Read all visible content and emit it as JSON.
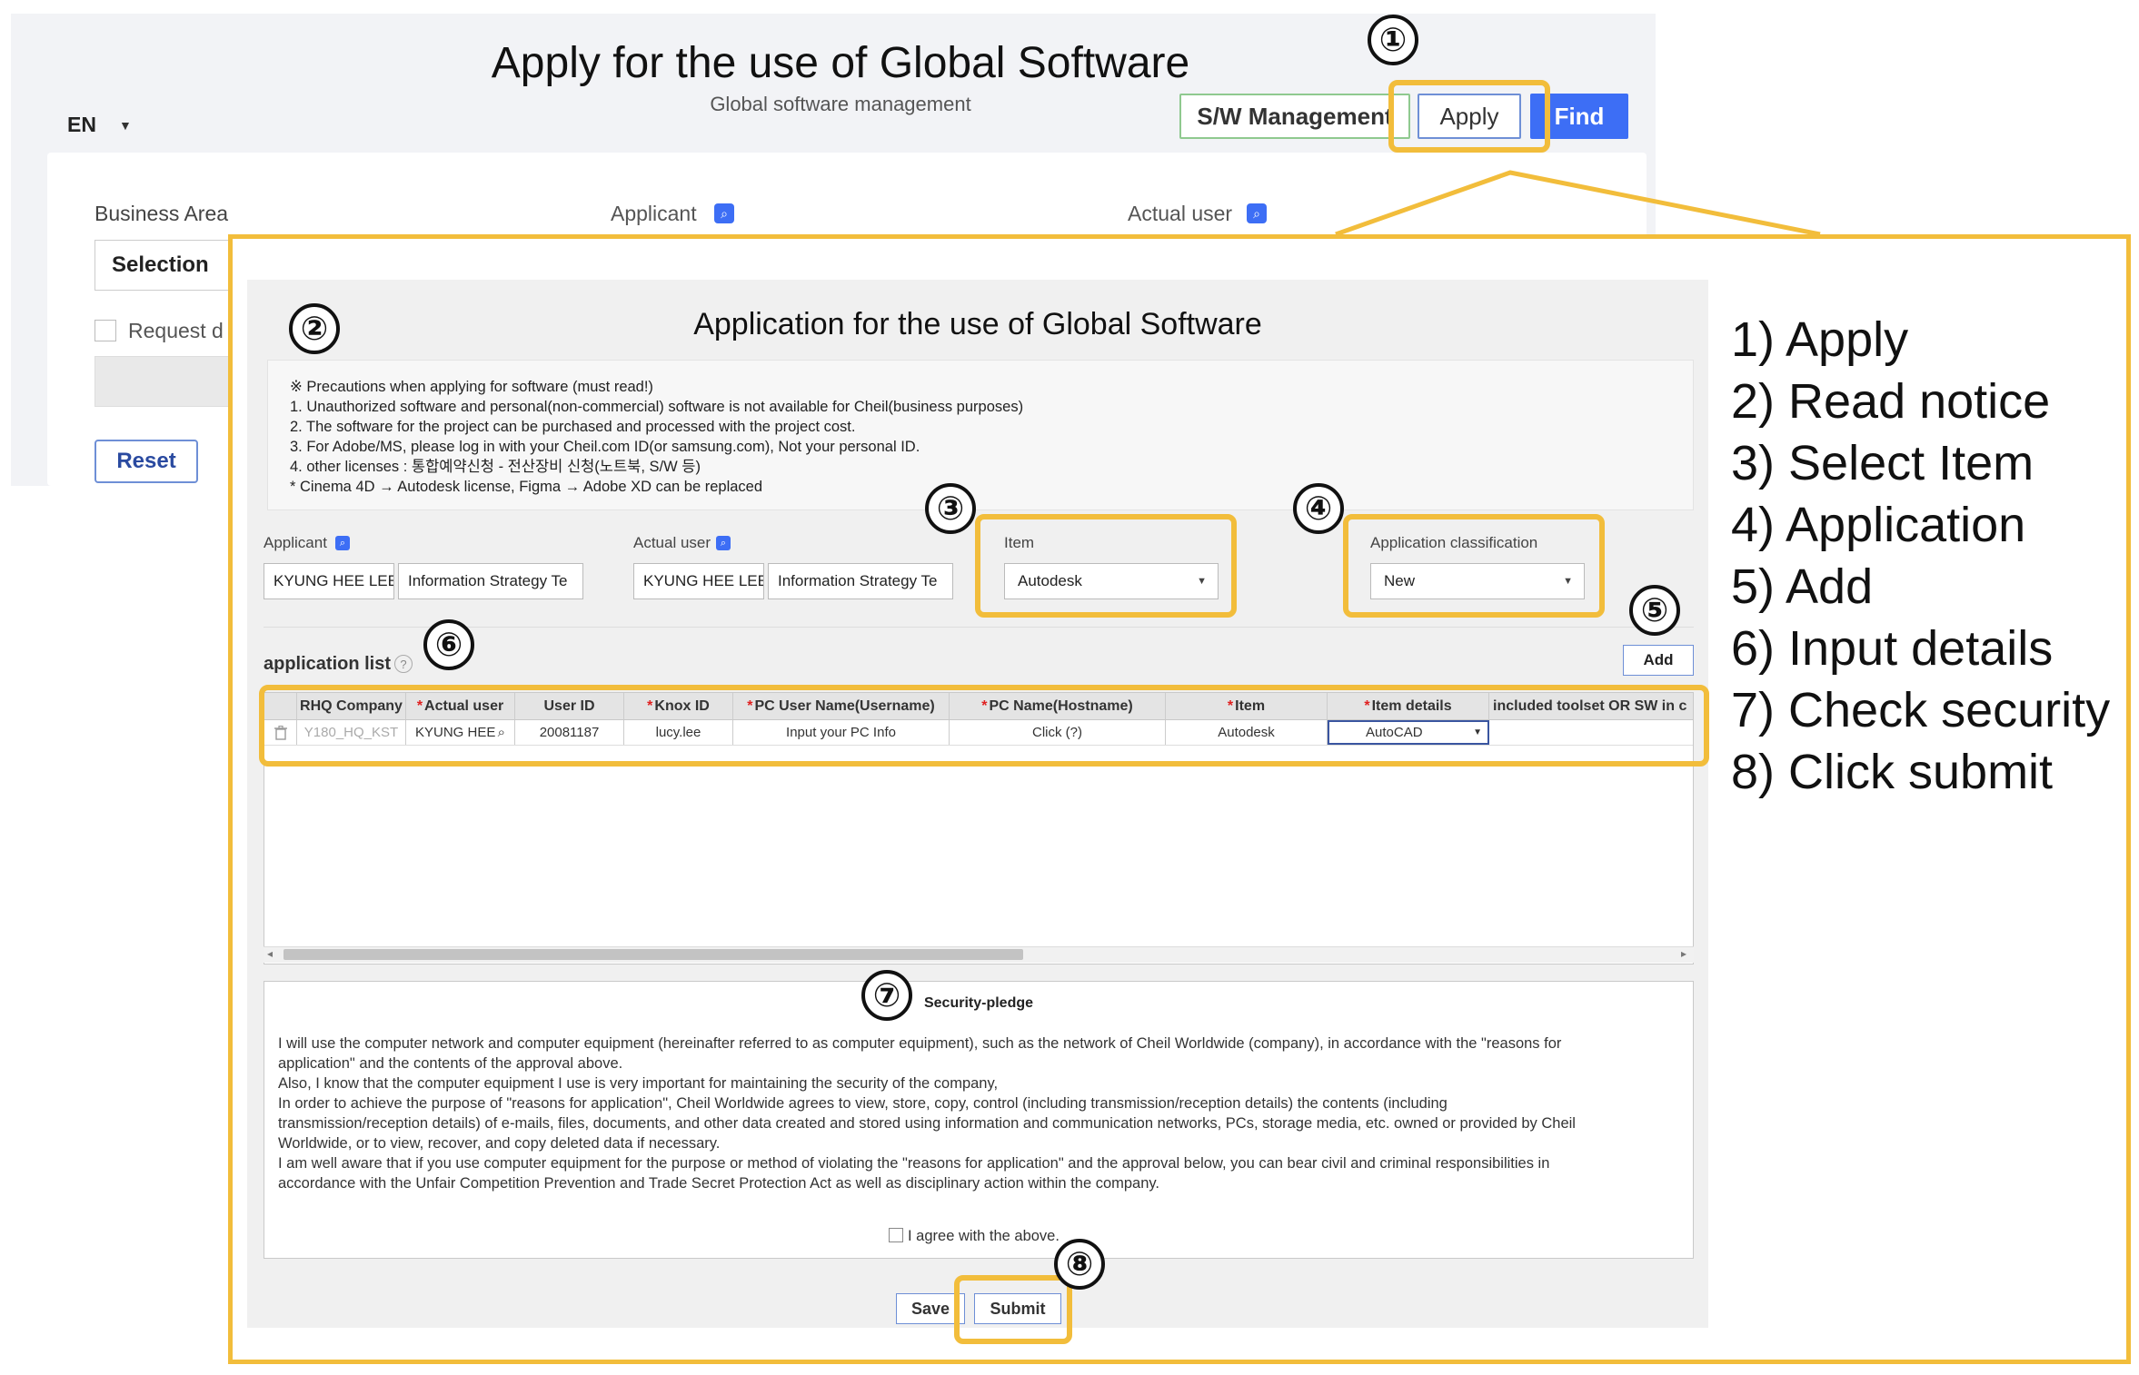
{
  "background": {
    "title": "Apply for the use of Global Software",
    "subtitle": "Global software management",
    "language": "EN",
    "buttons": {
      "sw_management": "S/W Management",
      "apply": "Apply",
      "find": "Find"
    },
    "labels": {
      "business_area": "Business Area",
      "applicant": "Applicant",
      "actual_user": "Actual user",
      "request": "Request d"
    },
    "business_area_value": "Selection",
    "reset": "Reset"
  },
  "modal": {
    "title": "Application for the use of Global Software",
    "notice": [
      "※ Precautions when applying for software (must read!)",
      "1. Unauthorized software and personal(non-commercial) software is not available for Cheil(business purposes)",
      "2. The software for the project can be purchased and processed with the project cost.",
      "3. For Adobe/MS, please log in with your Cheil.com ID(or samsung.com), Not your personal ID.",
      "4. other licenses : 통합예약신청 - 전산장비 신청(노트북, S/W 등)",
      "* Cinema 4D → Autodesk license, Figma → Adobe XD can be replaced"
    ],
    "form": {
      "applicant_label": "Applicant",
      "applicant_name": "KYUNG HEE LEE",
      "applicant_dept": "Information Strategy Te",
      "actual_user_label": "Actual user",
      "actual_user_name": "KYUNG HEE LEE",
      "actual_user_dept": "Information Strategy Te",
      "item_label": "Item",
      "item_value": "Autodesk",
      "classification_label": "Application classification",
      "classification_value": "New"
    },
    "application_list_label": "application list",
    "add_button": "Add",
    "grid": {
      "columns": [
        "RHQ Company",
        "Actual user",
        "User ID",
        "Knox ID",
        "PC User Name(Username)",
        "PC Name(Hostname)",
        "Item",
        "Item details",
        "included toolset OR SW in c"
      ],
      "required": [
        false,
        true,
        false,
        true,
        true,
        true,
        true,
        true,
        false
      ],
      "row": [
        "Y180_HQ_KST",
        "KYUNG HEE",
        "20081187",
        "lucy.lee",
        "Input your PC Info",
        "Click (?)",
        "Autodesk",
        "AutoCAD",
        ""
      ]
    },
    "pledge": {
      "title": "Security-pledge",
      "lines": [
        "I will use the computer network and computer equipment (hereinafter referred to as computer equipment), such as the network of Cheil Worldwide (company), in accordance with the \"reasons for",
        "application\" and the contents of the approval above.",
        "Also, I know that the computer equipment I use is very important for maintaining the security of the company,",
        "In order to achieve the purpose of \"reasons for application\", Cheil Worldwide agrees to view, store, copy, control (including transmission/reception details) the contents (including",
        "transmission/reception details) of e-mails, files, documents, and other data created and stored using information and communication networks, PCs, storage media, etc. owned or provided by Cheil",
        "Worldwide, or to view, recover, and copy deleted data if necessary.",
        "I am well aware that if you use computer equipment for the purpose or method of violating the \"reasons for application\" and the approval below, you can bear civil and criminal responsibilities in",
        "accordance with the Unfair Competition Prevention and Trade Secret Protection Act as well as disciplinary action within the company."
      ],
      "agree": "I agree with the above."
    },
    "save": "Save",
    "submit": "Submit"
  },
  "markers": [
    "①",
    "②",
    "③",
    "④",
    "⑤",
    "⑥",
    "⑦",
    "⑧"
  ],
  "steps": [
    "1) Apply",
    "2) Read notice",
    "3) Select Item",
    "4) Application",
    "5) Add",
    "6) Input details",
    "7) Check security",
    "8) Click submit"
  ],
  "icons": {
    "search": "search-icon",
    "help": "help-icon",
    "trash": "trash-icon",
    "caret": "caret-down-icon"
  },
  "colors": {
    "highlight": "#f2bd3b",
    "primary": "#3d6ef5",
    "required": "#e02020"
  }
}
